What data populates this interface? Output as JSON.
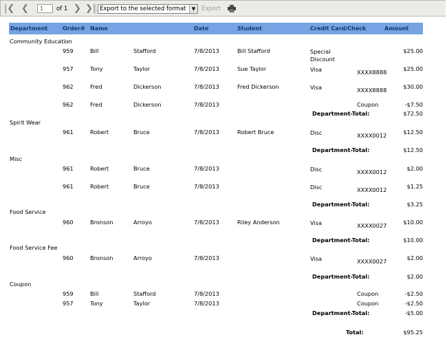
{
  "toolbar": {
    "page": "1",
    "of_pages": "of 1",
    "export_format": "Export to the selected format",
    "export_label": "Export",
    "icons": [
      "first-page-icon",
      "prev-page-icon",
      "next-page-icon",
      "last-page-icon",
      "dropdown-arrow-icon",
      "print-icon"
    ]
  },
  "headers": [
    "Department",
    "Order#",
    "Name",
    "Date",
    "Student",
    "Credit Card/Check",
    "Amount"
  ],
  "departments": [
    {
      "name": "Community Education",
      "total_label": "Department-Total:",
      "total": "$72.50",
      "rows": [
        {
          "order": "959",
          "first": "Bill",
          "last": "Stafford",
          "date": "7/8/2013",
          "student": "Bill Stafford",
          "pay": "Special",
          "pay2": "Discount",
          "card": "",
          "amount": "$25.00"
        },
        {
          "order": "957",
          "first": "Tony",
          "last": "Taylor",
          "date": "7/8/2013",
          "student": "Sue Taylor",
          "pay": "Visa",
          "pay2": "",
          "card": "XXXX8888",
          "amount": "$25.00"
        },
        {
          "order": "962",
          "first": "Fred",
          "last": "Dickerson",
          "date": "7/8/2013",
          "student": "Fred Dickerson",
          "pay": "Visa",
          "pay2": "",
          "card": "XXXX8888",
          "amount": "$30.00"
        },
        {
          "order": "962",
          "first": "Fred",
          "last": "Dickerson",
          "date": "7/8/2013",
          "student": "",
          "pay": "",
          "pay2": "",
          "card": "Coupon",
          "amount": "-$7.50"
        }
      ]
    },
    {
      "name": "Spirit Wear",
      "total_label": "Department-Total:",
      "total": "$12.50",
      "rows": [
        {
          "order": "961",
          "first": "Robert",
          "last": "Bruce",
          "date": "7/8/2013",
          "student": "Robert Bruce",
          "pay": "Disc",
          "pay2": "",
          "card": "XXXX0012",
          "amount": "$12.50"
        }
      ]
    },
    {
      "name": "Misc",
      "total_label": "Department-Total:",
      "total": "$3.25",
      "rows": [
        {
          "order": "961",
          "first": "Robert",
          "last": "Bruce",
          "date": "7/8/2013",
          "student": "",
          "pay": "Disc",
          "pay2": "",
          "card": "XXXX0012",
          "amount": "$2.00"
        },
        {
          "order": "961",
          "first": "Robert",
          "last": "Bruce",
          "date": "7/8/2013",
          "student": "",
          "pay": "Disc",
          "pay2": "",
          "card": "XXXX0012",
          "amount": "$1.25"
        }
      ]
    },
    {
      "name": "Food Service",
      "total_label": "Department-Total:",
      "total": "$10.00",
      "rows": [
        {
          "order": "960",
          "first": "Bronson",
          "last": "Arroyo",
          "date": "7/8/2013",
          "student": "Riley Anderson",
          "pay": "Visa",
          "pay2": "",
          "card": "XXXX0027",
          "amount": "$10.00"
        }
      ]
    },
    {
      "name": "Food Service Fee",
      "total_label": "Department-Total:",
      "total": "$2.00",
      "rows": [
        {
          "order": "960",
          "first": "Bronson",
          "last": "Arroyo",
          "date": "7/8/2013",
          "student": "",
          "pay": "Visa",
          "pay2": "",
          "card": "XXXX0027",
          "amount": "$2.00"
        }
      ]
    },
    {
      "name": "Coupon",
      "total_label": "Department-Total:",
      "total": "-$5.00",
      "rows": [
        {
          "order": "959",
          "first": "Bill",
          "last": "Stafford",
          "date": "7/8/2013",
          "student": "",
          "pay": "",
          "pay2": "",
          "card": "Coupon",
          "amount": "-$2.50"
        },
        {
          "order": "957",
          "first": "Tony",
          "last": "Taylor",
          "date": "7/8/2013",
          "student": "",
          "pay": "",
          "pay2": "",
          "card": "Coupon",
          "amount": "-$2.50"
        }
      ]
    }
  ],
  "grand_total_label": "Total:",
  "grand_total": "$95.25",
  "colors": {
    "header_bg": "#75a3e3",
    "header_text": "#143a6e",
    "toolbar_bg": "#ecebe6"
  }
}
